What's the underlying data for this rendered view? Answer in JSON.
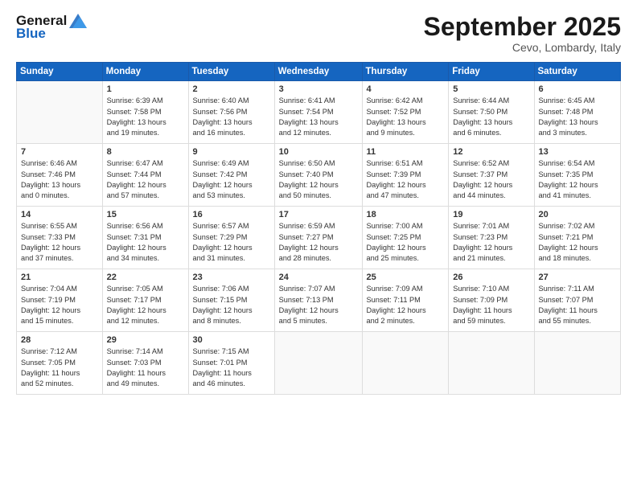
{
  "header": {
    "logo_line1": "General",
    "logo_line2": "Blue",
    "month": "September 2025",
    "location": "Cevo, Lombardy, Italy"
  },
  "weekdays": [
    "Sunday",
    "Monday",
    "Tuesday",
    "Wednesday",
    "Thursday",
    "Friday",
    "Saturday"
  ],
  "weeks": [
    [
      {
        "day": "",
        "info": ""
      },
      {
        "day": "1",
        "info": "Sunrise: 6:39 AM\nSunset: 7:58 PM\nDaylight: 13 hours\nand 19 minutes."
      },
      {
        "day": "2",
        "info": "Sunrise: 6:40 AM\nSunset: 7:56 PM\nDaylight: 13 hours\nand 16 minutes."
      },
      {
        "day": "3",
        "info": "Sunrise: 6:41 AM\nSunset: 7:54 PM\nDaylight: 13 hours\nand 12 minutes."
      },
      {
        "day": "4",
        "info": "Sunrise: 6:42 AM\nSunset: 7:52 PM\nDaylight: 13 hours\nand 9 minutes."
      },
      {
        "day": "5",
        "info": "Sunrise: 6:44 AM\nSunset: 7:50 PM\nDaylight: 13 hours\nand 6 minutes."
      },
      {
        "day": "6",
        "info": "Sunrise: 6:45 AM\nSunset: 7:48 PM\nDaylight: 13 hours\nand 3 minutes."
      }
    ],
    [
      {
        "day": "7",
        "info": "Sunrise: 6:46 AM\nSunset: 7:46 PM\nDaylight: 13 hours\nand 0 minutes."
      },
      {
        "day": "8",
        "info": "Sunrise: 6:47 AM\nSunset: 7:44 PM\nDaylight: 12 hours\nand 57 minutes."
      },
      {
        "day": "9",
        "info": "Sunrise: 6:49 AM\nSunset: 7:42 PM\nDaylight: 12 hours\nand 53 minutes."
      },
      {
        "day": "10",
        "info": "Sunrise: 6:50 AM\nSunset: 7:40 PM\nDaylight: 12 hours\nand 50 minutes."
      },
      {
        "day": "11",
        "info": "Sunrise: 6:51 AM\nSunset: 7:39 PM\nDaylight: 12 hours\nand 47 minutes."
      },
      {
        "day": "12",
        "info": "Sunrise: 6:52 AM\nSunset: 7:37 PM\nDaylight: 12 hours\nand 44 minutes."
      },
      {
        "day": "13",
        "info": "Sunrise: 6:54 AM\nSunset: 7:35 PM\nDaylight: 12 hours\nand 41 minutes."
      }
    ],
    [
      {
        "day": "14",
        "info": "Sunrise: 6:55 AM\nSunset: 7:33 PM\nDaylight: 12 hours\nand 37 minutes."
      },
      {
        "day": "15",
        "info": "Sunrise: 6:56 AM\nSunset: 7:31 PM\nDaylight: 12 hours\nand 34 minutes."
      },
      {
        "day": "16",
        "info": "Sunrise: 6:57 AM\nSunset: 7:29 PM\nDaylight: 12 hours\nand 31 minutes."
      },
      {
        "day": "17",
        "info": "Sunrise: 6:59 AM\nSunset: 7:27 PM\nDaylight: 12 hours\nand 28 minutes."
      },
      {
        "day": "18",
        "info": "Sunrise: 7:00 AM\nSunset: 7:25 PM\nDaylight: 12 hours\nand 25 minutes."
      },
      {
        "day": "19",
        "info": "Sunrise: 7:01 AM\nSunset: 7:23 PM\nDaylight: 12 hours\nand 21 minutes."
      },
      {
        "day": "20",
        "info": "Sunrise: 7:02 AM\nSunset: 7:21 PM\nDaylight: 12 hours\nand 18 minutes."
      }
    ],
    [
      {
        "day": "21",
        "info": "Sunrise: 7:04 AM\nSunset: 7:19 PM\nDaylight: 12 hours\nand 15 minutes."
      },
      {
        "day": "22",
        "info": "Sunrise: 7:05 AM\nSunset: 7:17 PM\nDaylight: 12 hours\nand 12 minutes."
      },
      {
        "day": "23",
        "info": "Sunrise: 7:06 AM\nSunset: 7:15 PM\nDaylight: 12 hours\nand 8 minutes."
      },
      {
        "day": "24",
        "info": "Sunrise: 7:07 AM\nSunset: 7:13 PM\nDaylight: 12 hours\nand 5 minutes."
      },
      {
        "day": "25",
        "info": "Sunrise: 7:09 AM\nSunset: 7:11 PM\nDaylight: 12 hours\nand 2 minutes."
      },
      {
        "day": "26",
        "info": "Sunrise: 7:10 AM\nSunset: 7:09 PM\nDaylight: 11 hours\nand 59 minutes."
      },
      {
        "day": "27",
        "info": "Sunrise: 7:11 AM\nSunset: 7:07 PM\nDaylight: 11 hours\nand 55 minutes."
      }
    ],
    [
      {
        "day": "28",
        "info": "Sunrise: 7:12 AM\nSunset: 7:05 PM\nDaylight: 11 hours\nand 52 minutes."
      },
      {
        "day": "29",
        "info": "Sunrise: 7:14 AM\nSunset: 7:03 PM\nDaylight: 11 hours\nand 49 minutes."
      },
      {
        "day": "30",
        "info": "Sunrise: 7:15 AM\nSunset: 7:01 PM\nDaylight: 11 hours\nand 46 minutes."
      },
      {
        "day": "",
        "info": ""
      },
      {
        "day": "",
        "info": ""
      },
      {
        "day": "",
        "info": ""
      },
      {
        "day": "",
        "info": ""
      }
    ]
  ]
}
